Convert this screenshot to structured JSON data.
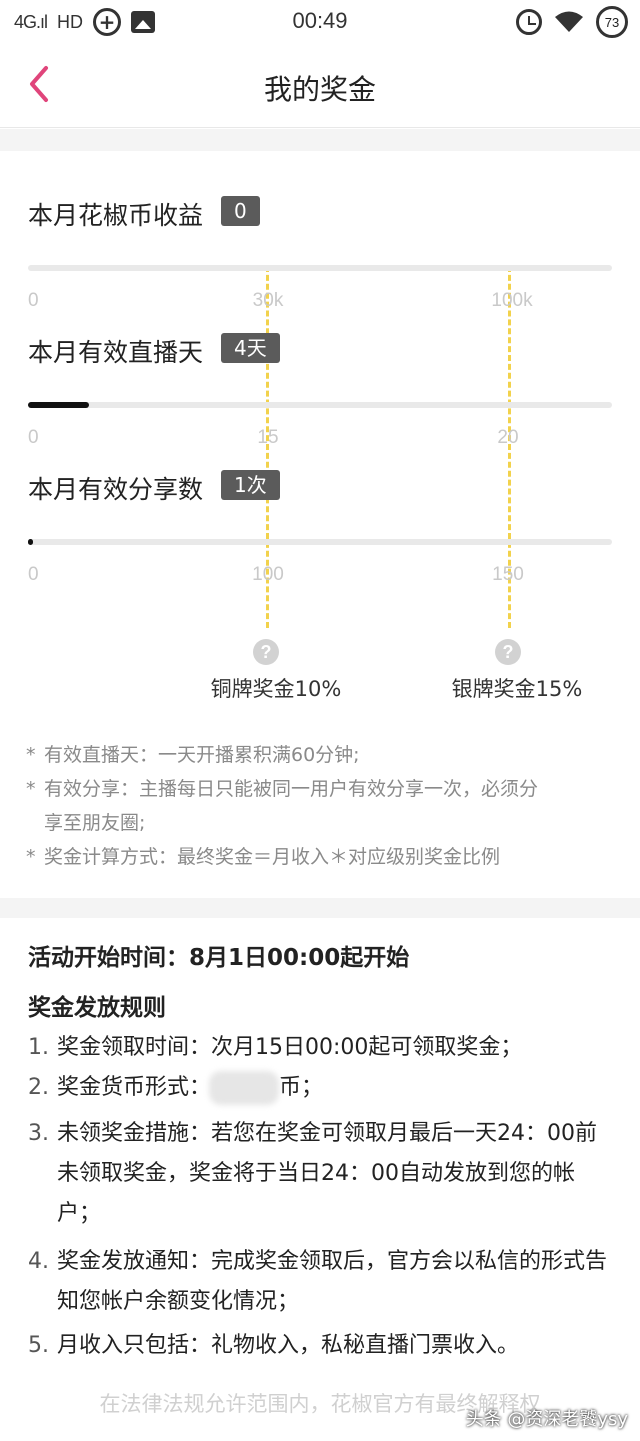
{
  "status_bar": {
    "network": "4G.ıl",
    "hd": "HD",
    "time": "00:49",
    "battery": "73"
  },
  "header": {
    "title": "我的奖金"
  },
  "metrics": [
    {
      "label": "本月花椒币收益",
      "badge": "0",
      "ticks": [
        "0",
        "30k",
        "100k"
      ],
      "progress": 0.0
    },
    {
      "label": "本月有效直播天",
      "badge": "4天",
      "ticks": [
        "0",
        "15",
        "20"
      ],
      "progress": 0.105
    },
    {
      "label": "本月有效分享数",
      "badge": "1次",
      "ticks": [
        "0",
        "100",
        "150"
      ],
      "progress": 0.008
    }
  ],
  "tiers": [
    {
      "label": "铜牌奖金10%",
      "help": "?"
    },
    {
      "label": "银牌奖金15%",
      "help": "?"
    }
  ],
  "notes": {
    "star": "*",
    "line1": "有效直播天：一天开播累积满60分钟;",
    "line2a": "有效分享：主播每日只能被同一用户有效分享一次，必须分",
    "line2b": "享至朋友圈;",
    "line3": "奖金计算方式：最终奖金＝月收入＊对应级别奖金比例"
  },
  "rules": {
    "start_time": "活动开始时间：8月1日00:00起开始",
    "heading": "奖金发放规则",
    "items": [
      {
        "num": "1.",
        "text": "奖金领取时间：次月15日00:00起可领取奖金；"
      },
      {
        "num": "2.",
        "text_a": "奖金货币形式：",
        "text_b": "币；"
      },
      {
        "num": "3.",
        "text": "未领奖金措施：若您在奖金可领取月最后一天24：00前未领取奖金，奖金将于当日24：00自动发放到您的帐户；"
      },
      {
        "num": "4.",
        "text": "奖金发放通知：完成奖金领取后，官方会以私信的形式告知您帐户余额变化情况；"
      },
      {
        "num": "5.",
        "text": "月收入只包括：礼物收入，私秘直播门票收入。"
      }
    ]
  },
  "footer": {
    "disclaimer": "在法律法规允许范围内，花椒官方有最终解释权",
    "watermark": "头条 @资深老饕ysy"
  },
  "colors": {
    "accent": "#e0457b",
    "badge_bg": "#5b5b5b",
    "threshold": "#f2d24c",
    "band": "#f4f4f4"
  }
}
